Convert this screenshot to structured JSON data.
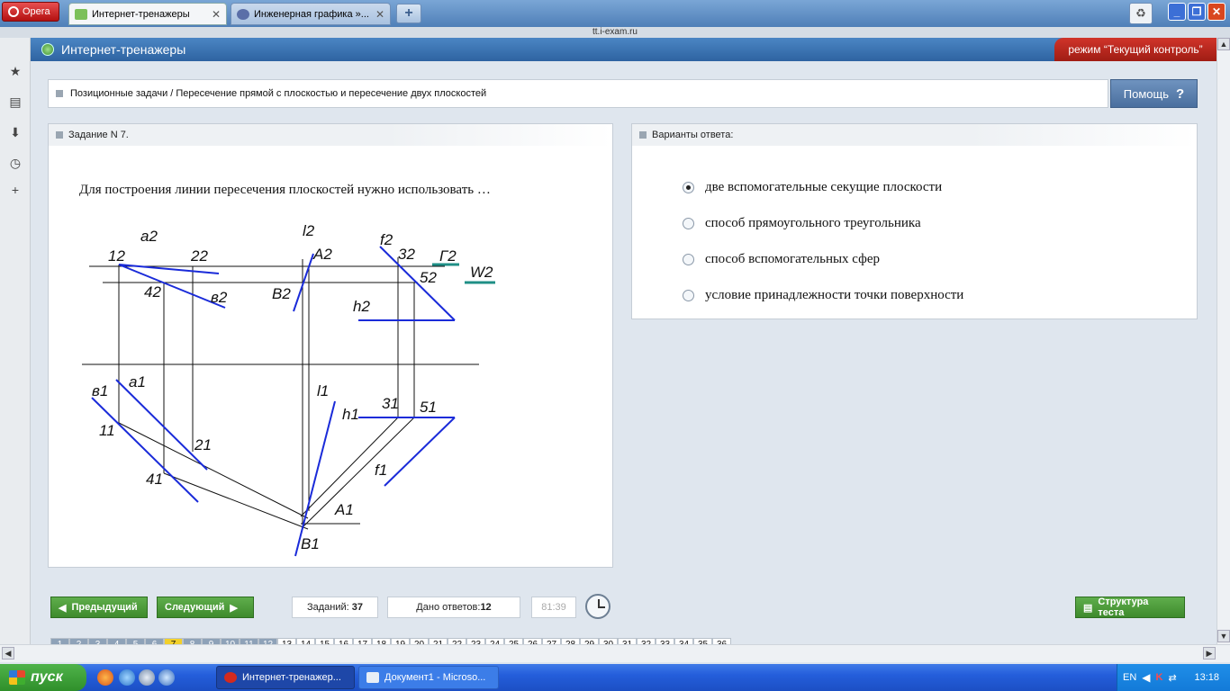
{
  "browser": {
    "opera_label": "Opera",
    "tabs": [
      {
        "label": "Интернет-тренажеры",
        "close": "✕"
      },
      {
        "label": "Инженерная графика »...",
        "close": "✕"
      }
    ],
    "new_tab": "+",
    "address": "tt.i-exam.ru"
  },
  "app": {
    "title": "Интернет-тренажеры",
    "mode": "режим “Текущий контроль”"
  },
  "breadcrumb": "Позиционные задачи / Пересечение прямой с плоскостью и пересечение двух плоскостей",
  "help_label": "Помощь",
  "help_icon": "?",
  "task": {
    "header": "Задание N 7.",
    "question": "Для построения линии пересечения плоскостей нужно использовать …",
    "diagram_labels": {
      "a2": "a2",
      "num22": "22",
      "num12": "12",
      "l2": "l2",
      "A2": "A2",
      "f2": "f2",
      "num32": "32",
      "G2": "Г2",
      "W2": "W2",
      "num42": "42",
      "b2": "в2",
      "B2": "B2",
      "num52": "52",
      "h2": "h2",
      "b1": "в1",
      "a1": "a1",
      "l1": "l1",
      "num31": "31",
      "num51": "51",
      "h1": "h1",
      "num11": "11",
      "num21": "21",
      "f1": "f1",
      "num41": "41",
      "A1": "A1",
      "B1": "B1"
    }
  },
  "answers": {
    "header": "Варианты ответа:",
    "options": [
      {
        "label": "две вспомогательные секущие плоскости",
        "selected": true
      },
      {
        "label": "способ прямоугольного треугольника",
        "selected": false
      },
      {
        "label": "способ вспомогательных сфер",
        "selected": false
      },
      {
        "label": "условие принадлежности точки поверхности",
        "selected": false
      }
    ]
  },
  "bottom": {
    "prev_label": "Предыдущий",
    "next_label": "Следующий",
    "tasks_label": "Заданий:",
    "tasks_value": "37",
    "answers_label": "Дано ответов:",
    "answers_value": "12",
    "timer": "81:39",
    "structure_label": "Структура теста",
    "pages": [
      "1",
      "2",
      "3",
      "4",
      "5",
      "6",
      "7",
      "8",
      "9",
      "10",
      "11",
      "12",
      "13",
      "14",
      "15",
      "16",
      "17",
      "18",
      "19",
      "20",
      "21",
      "22",
      "23",
      "24",
      "25",
      "26",
      "27",
      "28",
      "29",
      "30",
      "31",
      "32",
      "33",
      "34",
      "35",
      "36"
    ],
    "current_page": "7"
  },
  "taskbar": {
    "start_label": "пуск",
    "tasks": [
      "Интернет-тренажер...",
      "Документ1 - Microso..."
    ],
    "lang": "EN",
    "time": "13:18"
  }
}
